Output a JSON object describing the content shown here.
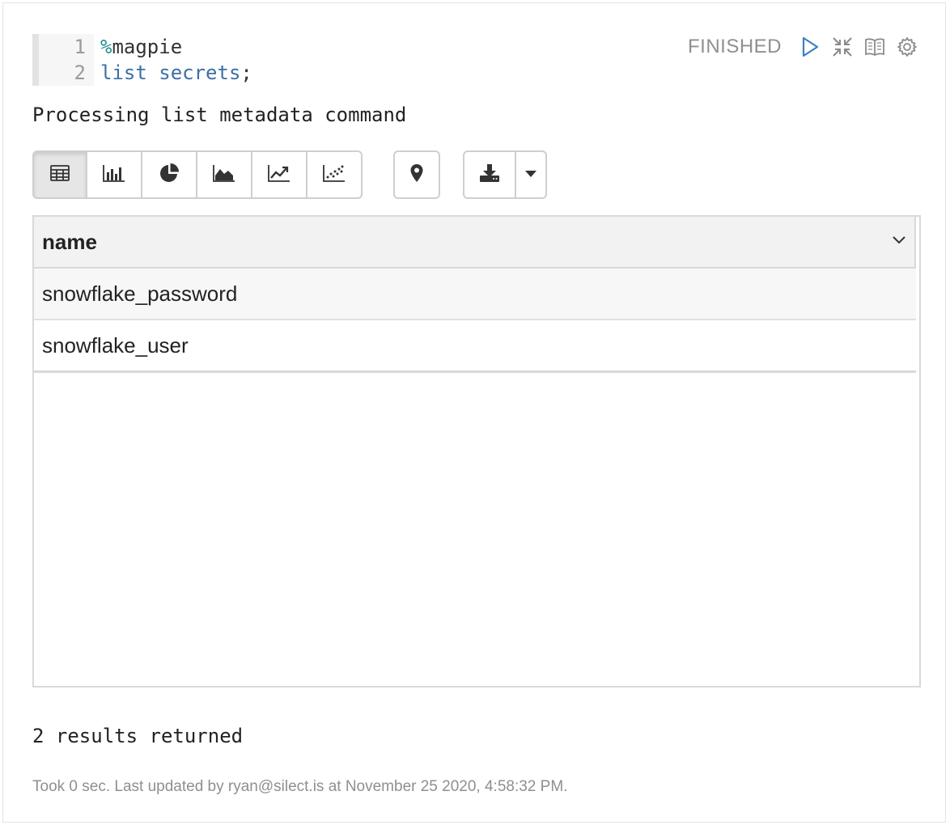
{
  "editor": {
    "line_numbers": [
      "1",
      "2"
    ],
    "line1_prefix": "%",
    "line1_rest": "magpie",
    "line2_keyword": "list secrets",
    "line2_end": ";"
  },
  "header": {
    "status": "FINISHED"
  },
  "output": {
    "message": "Processing list metadata command"
  },
  "toolbar": {
    "views": [
      "table-icon",
      "bar-chart-icon",
      "pie-chart-icon",
      "area-chart-icon",
      "line-chart-icon",
      "scatter-chart-icon"
    ],
    "active_view": "table-icon",
    "map_icon": "map-pin-icon",
    "download_icon": "download-icon",
    "caret_icon": "caret-down-icon"
  },
  "table": {
    "header": "name",
    "rows": [
      "snowflake_password",
      "snowflake_user"
    ]
  },
  "results_text": "2 results returned",
  "footer": "Took 0 sec. Last updated by ryan@silect.is at November 25 2020, 4:58:32 PM.",
  "colors": {
    "accent": "#3d7fc1",
    "status": "#8f8f8f",
    "code_keyword": "#3d6fa6",
    "code_directive": "#1f8f8f"
  }
}
